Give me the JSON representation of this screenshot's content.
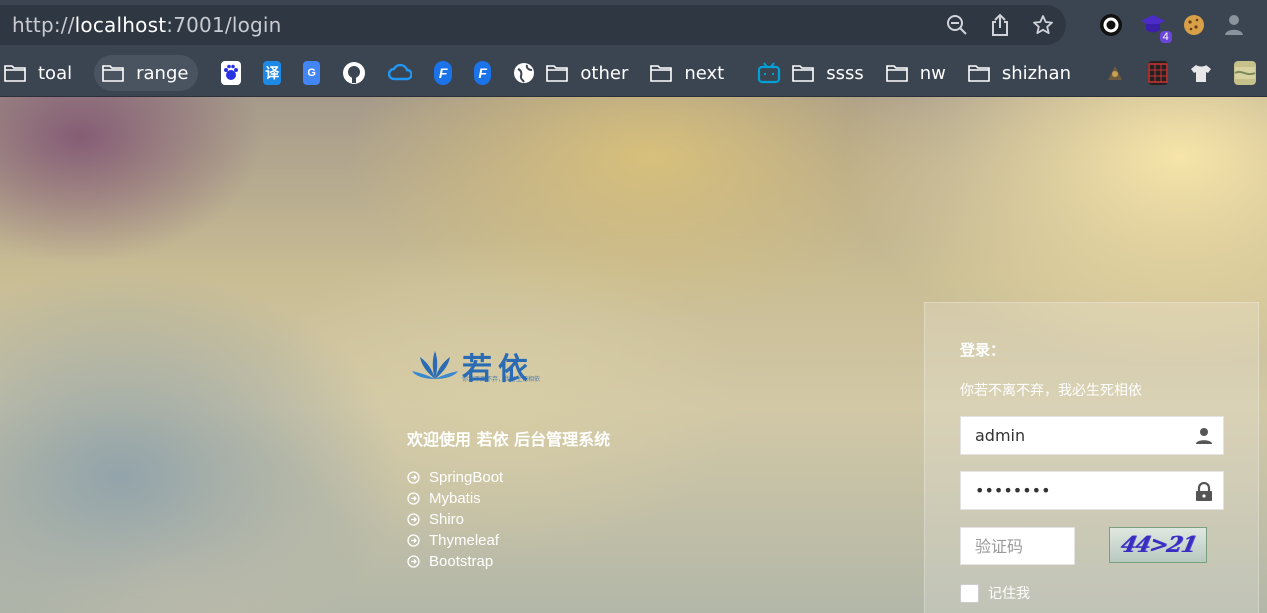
{
  "browser": {
    "url_scheme": "http://",
    "url_host": "localhost",
    "url_rest": ":7001/login",
    "extension_badge": "4"
  },
  "bookmarks": [
    {
      "type": "folder",
      "label": "toal"
    },
    {
      "type": "folder",
      "label": "range"
    },
    {
      "type": "icon",
      "name": "baidu-icon",
      "color": "#2932e1"
    },
    {
      "type": "icon",
      "name": "translate-icon",
      "color": "#1e88e5",
      "glyph": "译"
    },
    {
      "type": "icon",
      "name": "google-translate-icon",
      "color": "#4285f4"
    },
    {
      "type": "icon",
      "name": "github-icon",
      "color": "#ffffff"
    },
    {
      "type": "icon",
      "name": "cloud-icon",
      "color": "#2196f3"
    },
    {
      "type": "icon",
      "name": "f-app-icon",
      "color": "#1a73e8"
    },
    {
      "type": "icon",
      "name": "f-app-icon-2",
      "color": "#1a73e8"
    },
    {
      "type": "icon",
      "name": "globe-icon",
      "color": "#ffffff"
    },
    {
      "type": "folder",
      "label": "other"
    },
    {
      "type": "folder",
      "label": "next"
    },
    {
      "type": "icon",
      "name": "bilibili-icon",
      "color": "#00a1d6"
    },
    {
      "type": "folder",
      "label": "ssss"
    },
    {
      "type": "folder",
      "label": "nw"
    },
    {
      "type": "folder",
      "label": "shizhan"
    }
  ],
  "login_page": {
    "logo_text": "若依",
    "logo_sub": "你若不离不弃，我必生死相依",
    "welcome": "欢迎使用 若依 后台管理系统",
    "features": [
      "SpringBoot",
      "Mybatis",
      "Shiro",
      "Thymeleaf",
      "Bootstrap"
    ],
    "panel_title": "登录：",
    "panel_subtitle": "你若不离不弃，我必生死相依",
    "username_value": "admin",
    "password_value": "••••••••",
    "captcha_placeholder": "验证码",
    "captcha_text": "44>21",
    "remember_label": "记住我"
  },
  "colors": {
    "chrome_bg": "#3b4451",
    "logo_blue": "#2a6bb3",
    "captcha_ink": "#3a2ec0"
  }
}
